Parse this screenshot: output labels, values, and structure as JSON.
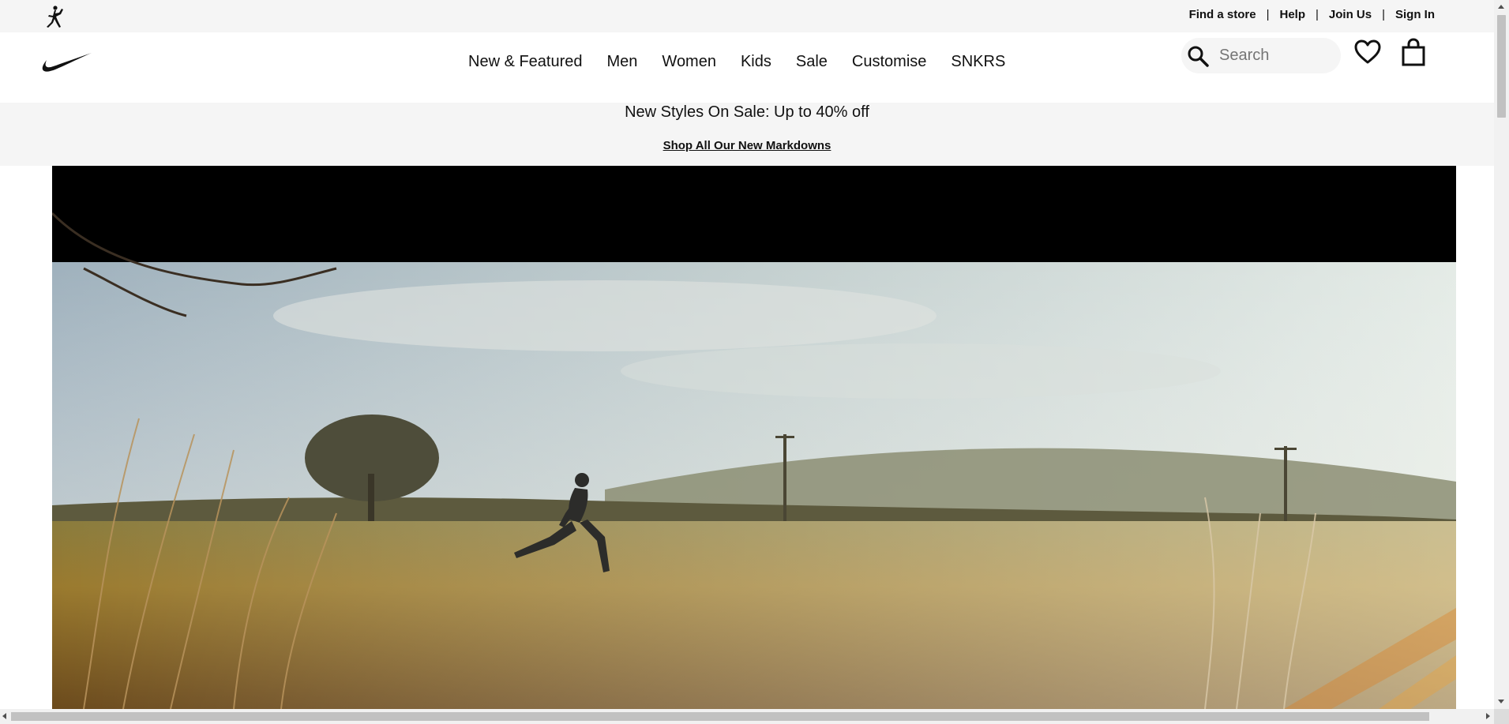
{
  "utility_bar": {
    "links": {
      "find_store": "Find a store",
      "help": "Help",
      "join_us": "Join Us",
      "sign_in": "Sign In"
    },
    "separator": "|"
  },
  "nav": {
    "items": {
      "new_featured": "New & Featured",
      "men": "Men",
      "women": "Women",
      "kids": "Kids",
      "sale": "Sale",
      "customise": "Customise",
      "snkrs": "SNKRS"
    },
    "search": {
      "placeholder": "Search",
      "value": ""
    }
  },
  "promo": {
    "title": "New Styles On Sale: Up to 40% off",
    "link": "Shop All Our New Markdowns"
  },
  "icons": {
    "brand_logo": "jordan-jumpman-icon",
    "main_logo": "nike-swoosh-icon",
    "search": "search-icon",
    "favourites": "heart-icon",
    "bag": "shopping-bag-icon"
  },
  "colors": {
    "utility_bg": "#f5f5f5",
    "text": "#111111",
    "hero_top": "#000000"
  }
}
